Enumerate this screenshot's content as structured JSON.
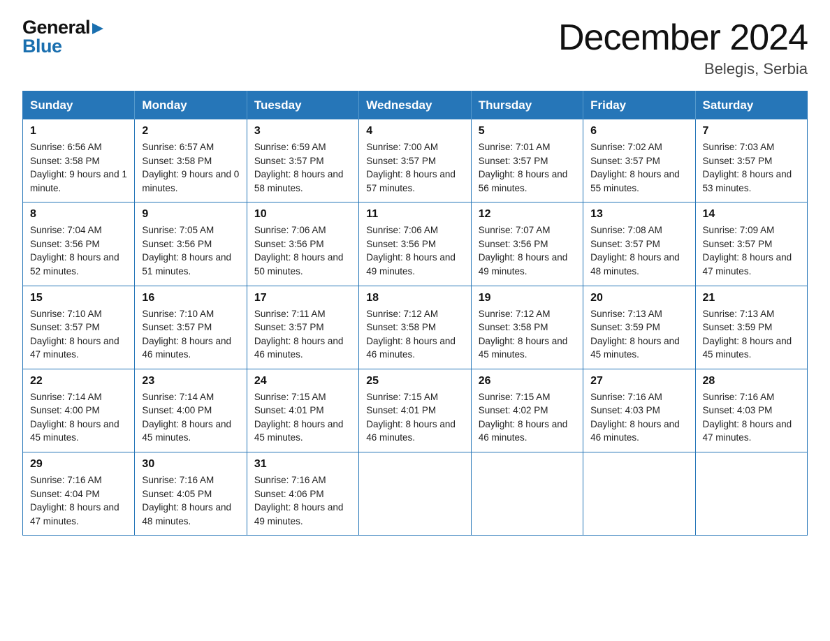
{
  "header": {
    "logo_general": "General",
    "logo_blue": "Blue",
    "month_title": "December 2024",
    "location": "Belegis, Serbia"
  },
  "calendar": {
    "days_of_week": [
      "Sunday",
      "Monday",
      "Tuesday",
      "Wednesday",
      "Thursday",
      "Friday",
      "Saturday"
    ],
    "weeks": [
      [
        {
          "day": "1",
          "sunrise": "6:56 AM",
          "sunset": "3:58 PM",
          "daylight": "9 hours and 1 minute."
        },
        {
          "day": "2",
          "sunrise": "6:57 AM",
          "sunset": "3:58 PM",
          "daylight": "9 hours and 0 minutes."
        },
        {
          "day": "3",
          "sunrise": "6:59 AM",
          "sunset": "3:57 PM",
          "daylight": "8 hours and 58 minutes."
        },
        {
          "day": "4",
          "sunrise": "7:00 AM",
          "sunset": "3:57 PM",
          "daylight": "8 hours and 57 minutes."
        },
        {
          "day": "5",
          "sunrise": "7:01 AM",
          "sunset": "3:57 PM",
          "daylight": "8 hours and 56 minutes."
        },
        {
          "day": "6",
          "sunrise": "7:02 AM",
          "sunset": "3:57 PM",
          "daylight": "8 hours and 55 minutes."
        },
        {
          "day": "7",
          "sunrise": "7:03 AM",
          "sunset": "3:57 PM",
          "daylight": "8 hours and 53 minutes."
        }
      ],
      [
        {
          "day": "8",
          "sunrise": "7:04 AM",
          "sunset": "3:56 PM",
          "daylight": "8 hours and 52 minutes."
        },
        {
          "day": "9",
          "sunrise": "7:05 AM",
          "sunset": "3:56 PM",
          "daylight": "8 hours and 51 minutes."
        },
        {
          "day": "10",
          "sunrise": "7:06 AM",
          "sunset": "3:56 PM",
          "daylight": "8 hours and 50 minutes."
        },
        {
          "day": "11",
          "sunrise": "7:06 AM",
          "sunset": "3:56 PM",
          "daylight": "8 hours and 49 minutes."
        },
        {
          "day": "12",
          "sunrise": "7:07 AM",
          "sunset": "3:56 PM",
          "daylight": "8 hours and 49 minutes."
        },
        {
          "day": "13",
          "sunrise": "7:08 AM",
          "sunset": "3:57 PM",
          "daylight": "8 hours and 48 minutes."
        },
        {
          "day": "14",
          "sunrise": "7:09 AM",
          "sunset": "3:57 PM",
          "daylight": "8 hours and 47 minutes."
        }
      ],
      [
        {
          "day": "15",
          "sunrise": "7:10 AM",
          "sunset": "3:57 PM",
          "daylight": "8 hours and 47 minutes."
        },
        {
          "day": "16",
          "sunrise": "7:10 AM",
          "sunset": "3:57 PM",
          "daylight": "8 hours and 46 minutes."
        },
        {
          "day": "17",
          "sunrise": "7:11 AM",
          "sunset": "3:57 PM",
          "daylight": "8 hours and 46 minutes."
        },
        {
          "day": "18",
          "sunrise": "7:12 AM",
          "sunset": "3:58 PM",
          "daylight": "8 hours and 46 minutes."
        },
        {
          "day": "19",
          "sunrise": "7:12 AM",
          "sunset": "3:58 PM",
          "daylight": "8 hours and 45 minutes."
        },
        {
          "day": "20",
          "sunrise": "7:13 AM",
          "sunset": "3:59 PM",
          "daylight": "8 hours and 45 minutes."
        },
        {
          "day": "21",
          "sunrise": "7:13 AM",
          "sunset": "3:59 PM",
          "daylight": "8 hours and 45 minutes."
        }
      ],
      [
        {
          "day": "22",
          "sunrise": "7:14 AM",
          "sunset": "4:00 PM",
          "daylight": "8 hours and 45 minutes."
        },
        {
          "day": "23",
          "sunrise": "7:14 AM",
          "sunset": "4:00 PM",
          "daylight": "8 hours and 45 minutes."
        },
        {
          "day": "24",
          "sunrise": "7:15 AM",
          "sunset": "4:01 PM",
          "daylight": "8 hours and 45 minutes."
        },
        {
          "day": "25",
          "sunrise": "7:15 AM",
          "sunset": "4:01 PM",
          "daylight": "8 hours and 46 minutes."
        },
        {
          "day": "26",
          "sunrise": "7:15 AM",
          "sunset": "4:02 PM",
          "daylight": "8 hours and 46 minutes."
        },
        {
          "day": "27",
          "sunrise": "7:16 AM",
          "sunset": "4:03 PM",
          "daylight": "8 hours and 46 minutes."
        },
        {
          "day": "28",
          "sunrise": "7:16 AM",
          "sunset": "4:03 PM",
          "daylight": "8 hours and 47 minutes."
        }
      ],
      [
        {
          "day": "29",
          "sunrise": "7:16 AM",
          "sunset": "4:04 PM",
          "daylight": "8 hours and 47 minutes."
        },
        {
          "day": "30",
          "sunrise": "7:16 AM",
          "sunset": "4:05 PM",
          "daylight": "8 hours and 48 minutes."
        },
        {
          "day": "31",
          "sunrise": "7:16 AM",
          "sunset": "4:06 PM",
          "daylight": "8 hours and 49 minutes."
        },
        null,
        null,
        null,
        null
      ]
    ]
  }
}
